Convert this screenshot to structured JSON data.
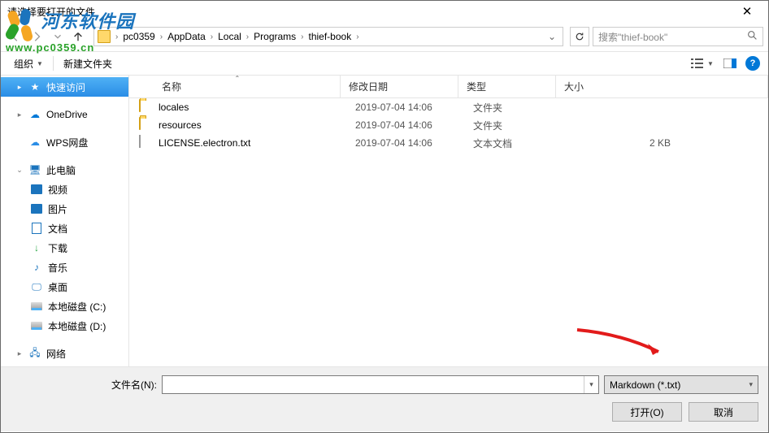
{
  "title": "请选择要打开的文件",
  "watermark": {
    "text": "河东软件园",
    "url": "www.pc0359.cn"
  },
  "breadcrumb": [
    "pc0359",
    "AppData",
    "Local",
    "Programs",
    "thief-book"
  ],
  "search_placeholder": "搜索\"thief-book\"",
  "toolbar": {
    "organize": "组织",
    "new_folder": "新建文件夹"
  },
  "columns": {
    "name": "名称",
    "date": "修改日期",
    "type": "类型",
    "size": "大小"
  },
  "sidebar": {
    "quick_access": "快速访问",
    "onedrive": "OneDrive",
    "wps": "WPS网盘",
    "this_pc": "此电脑",
    "videos": "视频",
    "pictures": "图片",
    "documents": "文档",
    "downloads": "下载",
    "music": "音乐",
    "desktop": "桌面",
    "disk_c": "本地磁盘 (C:)",
    "disk_d": "本地磁盘 (D:)",
    "network": "网络"
  },
  "files": [
    {
      "name": "locales",
      "date": "2019-07-04 14:06",
      "type": "文件夹",
      "size": "",
      "kind": "folder"
    },
    {
      "name": "resources",
      "date": "2019-07-04 14:06",
      "type": "文件夹",
      "size": "",
      "kind": "folder"
    },
    {
      "name": "LICENSE.electron.txt",
      "date": "2019-07-04 14:06",
      "type": "文本文档",
      "size": "2 KB",
      "kind": "txt"
    }
  ],
  "footer": {
    "filename_label": "文件名(N):",
    "filter": "Markdown (*.txt)",
    "open": "打开(O)",
    "cancel": "取消"
  }
}
